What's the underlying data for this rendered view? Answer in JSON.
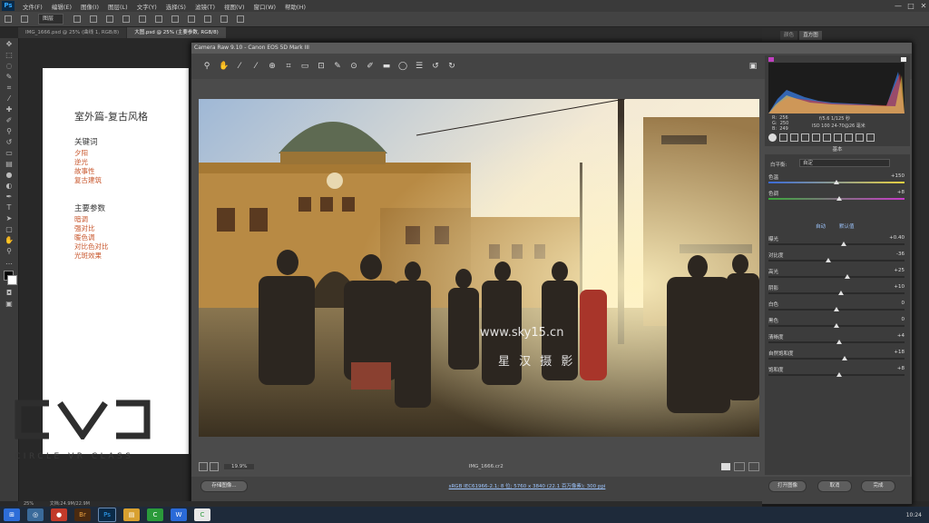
{
  "menubar": {
    "logo": "Ps",
    "items": [
      "文件(F)",
      "编辑(E)",
      "图像(I)",
      "图层(L)",
      "文字(Y)",
      "选择(S)",
      "滤镜(T)",
      "视图(V)",
      "窗口(W)",
      "帮助(H)"
    ],
    "controls": [
      "—",
      "□",
      "✕"
    ]
  },
  "optbar": {
    "select_value": "图层"
  },
  "tabs": [
    {
      "label": "IMG_1666.psd @ 25% (曲线 1, RGB/8)",
      "active": false
    },
    {
      "label": "大图.psd @ 25% (主要参数, RGB/8)",
      "active": true
    }
  ],
  "document": {
    "title": "室外篇-复古风格",
    "section1_heading": "关键词",
    "keywords": [
      "夕阳",
      "逆光",
      "故事性",
      "复古建筑"
    ],
    "section2_heading": "主要参数",
    "params": [
      "暗调",
      "强对比",
      "暖色调",
      "对比色对比",
      "光斑效果"
    ],
    "logo_text": "CIRCLE VR CLASS"
  },
  "right_panel_tabs": [
    "颜色",
    "直方图"
  ],
  "camera_raw": {
    "title": "Camera Raw 9.10  -  Canon EOS 5D Mark III",
    "watermark": "www.sky15.cn",
    "watermark2": "星 汉 摄 影",
    "rgb_readout": "R:  256\nG:  250\nB:  249",
    "exif_line1": "f/5.6    1/125 秒",
    "exif_line2": "ISO 100    24-70@26 毫米",
    "panel_title": "基本",
    "white_balance_label": "白平衡:",
    "white_balance_value": "自定",
    "auto_label": "自动",
    "default_label": "默认值",
    "sliders": [
      {
        "label": "色温",
        "value": "+150",
        "pos": 0.5
      },
      {
        "label": "色调",
        "value": "+8",
        "pos": 0.52
      },
      {
        "label": "曝光",
        "value": "+0.40",
        "pos": 0.55
      },
      {
        "label": "对比度",
        "value": "-36",
        "pos": 0.44
      },
      {
        "label": "高光",
        "value": "+25",
        "pos": 0.58
      },
      {
        "label": "阴影",
        "value": "+10",
        "pos": 0.53
      },
      {
        "label": "白色",
        "value": "0",
        "pos": 0.5
      },
      {
        "label": "黑色",
        "value": "0",
        "pos": 0.5
      },
      {
        "label": "清晰度",
        "value": "+4",
        "pos": 0.52
      },
      {
        "label": "自然饱和度",
        "value": "+18",
        "pos": 0.56
      },
      {
        "label": "饱和度",
        "value": "+8",
        "pos": 0.52
      }
    ],
    "zoom_value": "19.9%",
    "file_name": "IMG_1666.cr2",
    "workflow_link": "sRGB IEC61966-2.1; 8 位; 5760 x 3840 (22.1 百万像素); 300 ppi",
    "btn_save": "存储图像...",
    "btn_open": "打开图像",
    "btn_cancel": "取消",
    "btn_done": "完成"
  },
  "status": {
    "zoom": "25%",
    "doc": "文档:24.9M/22.9M"
  },
  "taskbar": {
    "apps": [
      "⊞",
      "◎",
      "●",
      "Br",
      "Ps",
      "▤",
      "C",
      "W",
      "C"
    ],
    "time": "10:24"
  },
  "colors": {
    "accent": "#31a8ff",
    "doc_keyword": "#c8572d"
  }
}
